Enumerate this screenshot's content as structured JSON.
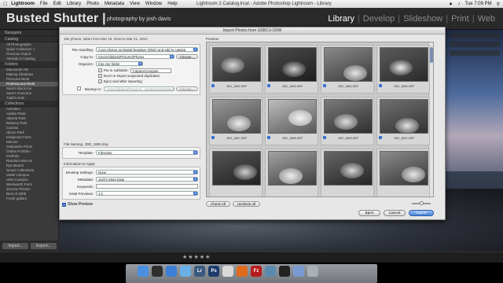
{
  "menubar": {
    "app": "Lightroom",
    "items": [
      "File",
      "Edit",
      "Library",
      "Photo",
      "Metadata",
      "View",
      "Window",
      "Help"
    ],
    "window_title": "Lightroom 2 Catalog.lrcat - Adobe Photoshop Lightroom - Library",
    "clock": "Tue 7:09 PM"
  },
  "header": {
    "brand": "Busted Shutter |",
    "brand_sub": "photography by josh davis",
    "modules": [
      "Library",
      "Develop",
      "Slideshow",
      "Print",
      "Web"
    ],
    "active_module": "Library"
  },
  "left_panel": {
    "navigator": "Navigator",
    "catalog": "Catalog",
    "catalog_items": [
      {
        "label": "All Photographs",
        "count": ""
      },
      {
        "label": "Quick Collection +",
        "count": ""
      },
      {
        "label": "Previous Import",
        "count": ""
      },
      {
        "label": "Already in Catalog",
        "count": ""
      }
    ],
    "folders": "Folders",
    "folder_items": [
      {
        "label": "Macintosh HD",
        "count": ""
      },
      {
        "label": "Making Shadows",
        "count": ""
      },
      {
        "label": "Personal Work",
        "count": ""
      },
      {
        "label": "Professional Work",
        "count": ""
      },
      {
        "label": "Sara's Block Inv",
        "count": ""
      },
      {
        "label": "Sara's Outcome",
        "count": ""
      },
      {
        "label": "Todd's Dels",
        "count": ""
      }
    ],
    "collections": "Collections",
    "collection_items": [
      "Activities",
      "Adobe Plant",
      "Alberta Park",
      "Bellamy Park",
      "Canvas",
      "Hilson Park",
      "Kingsman Farm",
      "Mercier",
      "Oaklanthe Prints",
      "Online Portfolio",
      "Portfolio",
      "Random Marcon",
      "Rye Beach",
      "Smart Collections",
      "uWell Campus",
      "UNH Campus",
      "Wentworth Farm",
      "Sunrise Photos",
      "Best of 2009",
      "Fresh gallery"
    ],
    "import_label": "Import...",
    "export_label": "Export..."
  },
  "dialog": {
    "title": "Import Photos from USB2.0-CRW",
    "summary": "192 photos, taken from Mar 18, 2010 to Mar 21, 2010",
    "file_handling_label": "File Handling:",
    "file_handling_value": "Copy photos as Digital Negative (DNG) and add to catalog",
    "copy_to_label": "Copy to:",
    "copy_to_value": "/Users/jddavis/Pictures/Photos",
    "choose_label": "Choose...",
    "organize_label": "Organize:",
    "organize_value": "Into one folder",
    "put_in_subfolder_label": "Put in subfolder:",
    "put_in_subfolder_value": "CaptureCompare",
    "dont_reimport_label": "Don't re-import suspected duplicates",
    "eject_card_label": "Eject card after importing",
    "backup_to_label": "Backup to:",
    "backup_to_value": "/Users/jddavis/Pictures/...ons/Download Backups",
    "backup_choose_label": "Choose...",
    "file_naming": "File Naming: JDD_1882.dng",
    "template_label": "Template:",
    "template_value": "Filename",
    "info_to_apply": "Information to Apply",
    "develop_settings_label": "Develop Settings:",
    "develop_settings_value": "None",
    "metadata_label": "Metadata:",
    "metadata_value": "Josh's Meta Data",
    "keywords_label": "Keywords:",
    "keywords_value": "",
    "initial_previews_label": "Initial Previews:",
    "initial_previews_value": "1:1",
    "show_preview_label": "Show Preview",
    "preview_label": "Preview",
    "thumbnails": [
      "JDD_1882.NEF",
      "JDD_1883.NEF",
      "JDD_1884.NEF",
      "JDD_1885.NEF",
      "JDD_1887.NEF",
      "JDD_1888.NEF",
      "JDD_1889.NEF",
      "JDD_1891.NEF",
      "",
      "",
      "",
      ""
    ],
    "check_all_label": "Check All",
    "uncheck_all_label": "Uncheck All",
    "eject_label": "Eject",
    "cancel_label": "Cancel",
    "import_label": "Import"
  },
  "bottom_bar": {
    "stars": "★★★★★"
  },
  "colors": {
    "accent_blue": "#3b6fd1",
    "header_bg": "#2a2a2a",
    "dialog_bg": "#e7e7e7"
  }
}
